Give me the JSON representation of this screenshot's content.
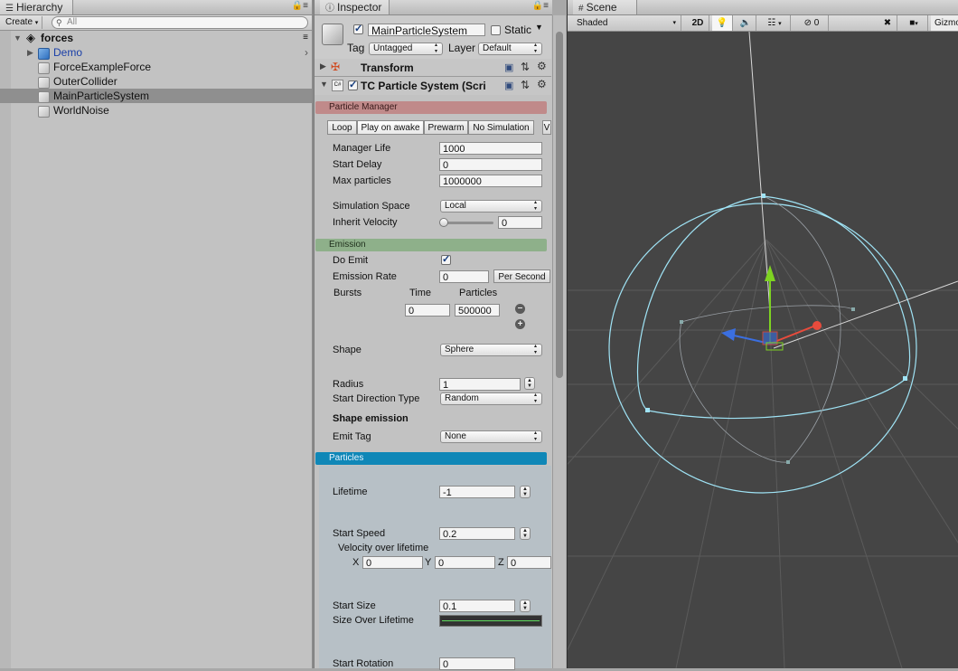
{
  "hierarchy": {
    "tab_title": "Hierarchy",
    "create_label": "Create",
    "search_placeholder": "All",
    "scene_name": "forces",
    "items": [
      {
        "label": "Demo"
      },
      {
        "label": "ForceExampleForce"
      },
      {
        "label": "OuterCollider"
      },
      {
        "label": "MainParticleSystem"
      },
      {
        "label": "WorldNoise"
      }
    ]
  },
  "inspector": {
    "tab_title": "Inspector",
    "object_name": "MainParticleSystem",
    "static_label": "Static",
    "tag_label": "Tag",
    "tag_value": "Untagged",
    "layer_label": "Layer",
    "layer_value": "Default",
    "transform_label": "Transform",
    "component_label": "TC Particle System (Scri",
    "particle_manager": {
      "header": "Particle Manager",
      "toggles": [
        "Loop",
        "Play on awake",
        "Prewarm",
        "No Simulation",
        "V"
      ],
      "manager_life_label": "Manager Life",
      "manager_life_value": "1000",
      "start_delay_label": "Start Delay",
      "start_delay_value": "0",
      "max_particles_label": "Max particles",
      "max_particles_value": "1000000",
      "simulation_space_label": "Simulation Space",
      "simulation_space_value": "Local",
      "inherit_velocity_label": "Inherit Velocity",
      "inherit_velocity_value": "0",
      "inherit_velocity_level": 0
    },
    "emission": {
      "header": "Emission",
      "do_emit_label": "Do Emit",
      "emission_rate_label": "Emission Rate",
      "emission_rate_value": "0",
      "rate_mode": "Per Second",
      "bursts_label": "Bursts",
      "time_header": "Time",
      "particles_header": "Particles",
      "burst_time": "0",
      "burst_particles": "500000",
      "remove_icon": "minus-circle-icon",
      "add_icon": "plus-circle-icon",
      "shape_label": "Shape",
      "shape_value": "Sphere",
      "radius_label": "Radius",
      "radius_value": "1",
      "start_direction_label": "Start Direction Type",
      "start_direction_value": "Random",
      "shape_emission_label": "Shape emission",
      "emit_tag_label": "Emit Tag",
      "emit_tag_value": "None"
    },
    "particles": {
      "header": "Particles",
      "lifetime_label": "Lifetime",
      "lifetime_value": "-1",
      "start_speed_label": "Start Speed",
      "start_speed_value": "0.2",
      "velocity_label": "Velocity over lifetime",
      "x_label": "X",
      "x_value": "0",
      "y_label": "Y",
      "y_value": "0",
      "z_label": "Z",
      "z_value": "0",
      "start_size_label": "Start Size",
      "start_size_value": "0.1",
      "size_over_lifetime_label": "Size Over Lifetime",
      "start_rotation_label": "Start Rotation",
      "start_rotation_value": "0"
    }
  },
  "scene": {
    "tab_title": "Scene",
    "draw_mode": "Shaded",
    "mode_2d": "2D",
    "hidden_count": "0",
    "gizmos_label": "Gizmos"
  },
  "colors": {
    "panel_bg": "#c2c2c2",
    "selection": "#8f8f8f",
    "particle_manager_header": "#c08a8a",
    "emission_header": "#8eb08a",
    "particles_header": "#0f87b7",
    "scene_bg": "#454545",
    "gizmo_sphere": "#9fe3f5"
  }
}
